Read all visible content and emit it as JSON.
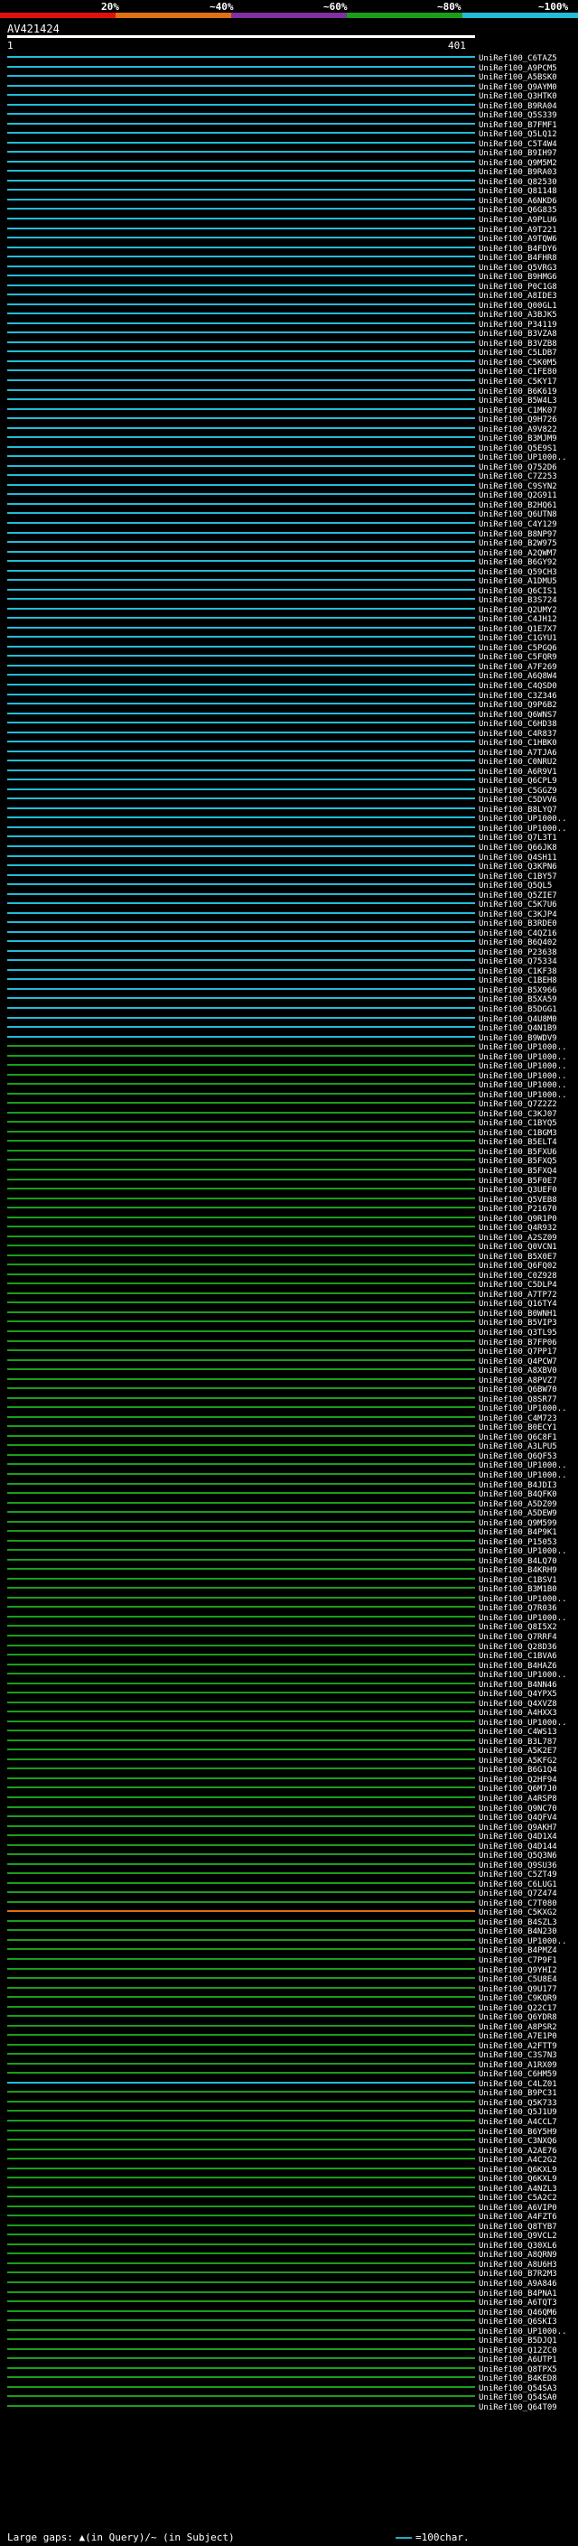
{
  "legend": {
    "labels": [
      "20%",
      "~40%",
      "~60%",
      "~80%",
      "~100%"
    ],
    "colors": [
      "#e01010",
      "#e07010",
      "#8030a0",
      "#1a9e1a",
      "#22bcd8"
    ]
  },
  "query": {
    "name": "AV421424",
    "start": "1",
    "end": "401"
  },
  "footer": {
    "text": "Large gaps: ▲(in Query)/~ (in Subject)",
    "scale_label": "=100char."
  },
  "hits": [
    {
      "id": "UniRef100_C6TAZ5",
      "identity": "100"
    },
    {
      "id": "UniRef100_A9PCM5",
      "identity": "100"
    },
    {
      "id": "UniRef100_A5BSK0",
      "identity": "100"
    },
    {
      "id": "UniRef100_Q9AYM0",
      "identity": "100"
    },
    {
      "id": "UniRef100_Q3HTK0",
      "identity": "100"
    },
    {
      "id": "UniRef100_B9RA04",
      "identity": "100"
    },
    {
      "id": "UniRef100_Q5S339",
      "identity": "100"
    },
    {
      "id": "UniRef100_B7FMF1",
      "identity": "100"
    },
    {
      "id": "UniRef100_Q5LQ12",
      "identity": "100"
    },
    {
      "id": "UniRef100_C5T4W4",
      "identity": "100"
    },
    {
      "id": "UniRef100_B9IH97",
      "identity": "100"
    },
    {
      "id": "UniRef100_Q9M5M2",
      "identity": "100"
    },
    {
      "id": "UniRef100_B9RA03",
      "identity": "100"
    },
    {
      "id": "UniRef100_Q82530",
      "identity": "100"
    },
    {
      "id": "UniRef100_Q81148",
      "identity": "100"
    },
    {
      "id": "UniRef100_A6NKD6",
      "identity": "100"
    },
    {
      "id": "UniRef100_Q6G835",
      "identity": "100"
    },
    {
      "id": "UniRef100_A9PLU6",
      "identity": "100"
    },
    {
      "id": "UniRef100_A9T221",
      "identity": "100"
    },
    {
      "id": "UniRef100_A9TQW6",
      "identity": "100"
    },
    {
      "id": "UniRef100_B4FDY6",
      "identity": "100"
    },
    {
      "id": "UniRef100_B4FHR8",
      "identity": "100"
    },
    {
      "id": "UniRef100_Q5VRG3",
      "identity": "100"
    },
    {
      "id": "UniRef100_B9HMG6",
      "identity": "100"
    },
    {
      "id": "UniRef100_P0C1G8",
      "identity": "100"
    },
    {
      "id": "UniRef100_A8IDE3",
      "identity": "100"
    },
    {
      "id": "UniRef100_Q00GL1",
      "identity": "100"
    },
    {
      "id": "UniRef100_A3BJK5",
      "identity": "100"
    },
    {
      "id": "UniRef100_P34119",
      "identity": "100"
    },
    {
      "id": "UniRef100_B3VZA8",
      "identity": "100"
    },
    {
      "id": "UniRef100_B3VZB8",
      "identity": "100"
    },
    {
      "id": "UniRef100_C5LDB7",
      "identity": "100"
    },
    {
      "id": "UniRef100_C5K0M5",
      "identity": "100"
    },
    {
      "id": "UniRef100_C1FE80",
      "identity": "100"
    },
    {
      "id": "UniRef100_C5KY17",
      "identity": "100"
    },
    {
      "id": "UniRef100_B6K619",
      "identity": "100"
    },
    {
      "id": "UniRef100_B5W4L3",
      "identity": "100"
    },
    {
      "id": "UniRef100_C1MK07",
      "identity": "100"
    },
    {
      "id": "UniRef100_Q9H726",
      "identity": "100"
    },
    {
      "id": "UniRef100_A9V822",
      "identity": "100"
    },
    {
      "id": "UniRef100_B3MJM9",
      "identity": "100"
    },
    {
      "id": "UniRef100_Q5E9S1",
      "identity": "100"
    },
    {
      "id": "UniRef100_UP1000..",
      "identity": "100"
    },
    {
      "id": "UniRef100_Q752D6",
      "identity": "100"
    },
    {
      "id": "UniRef100_C7Z253",
      "identity": "100"
    },
    {
      "id": "UniRef100_C9SYN2",
      "identity": "100"
    },
    {
      "id": "UniRef100_Q2G911",
      "identity": "100"
    },
    {
      "id": "UniRef100_B2HQ61",
      "identity": "100"
    },
    {
      "id": "UniRef100_Q6UTN8",
      "identity": "100"
    },
    {
      "id": "UniRef100_C4Y129",
      "identity": "100"
    },
    {
      "id": "UniRef100_B8NP97",
      "identity": "100"
    },
    {
      "id": "UniRef100_B2W975",
      "identity": "100"
    },
    {
      "id": "UniRef100_A2QWM7",
      "identity": "100"
    },
    {
      "id": "UniRef100_B6GY92",
      "identity": "100"
    },
    {
      "id": "UniRef100_Q59CH3",
      "identity": "100"
    },
    {
      "id": "UniRef100_A1DMU5",
      "identity": "100"
    },
    {
      "id": "UniRef100_Q6CIS1",
      "identity": "100"
    },
    {
      "id": "UniRef100_B3S724",
      "identity": "100"
    },
    {
      "id": "UniRef100_Q2UMY2",
      "identity": "100"
    },
    {
      "id": "UniRef100_C4JH12",
      "identity": "100"
    },
    {
      "id": "UniRef100_Q1E7X7",
      "identity": "100"
    },
    {
      "id": "UniRef100_C1GYU1",
      "identity": "100"
    },
    {
      "id": "UniRef100_C5PGQ6",
      "identity": "100"
    },
    {
      "id": "UniRef100_C5FQR9",
      "identity": "100"
    },
    {
      "id": "UniRef100_A7F269",
      "identity": "100"
    },
    {
      "id": "UniRef100_A6Q8W4",
      "identity": "100"
    },
    {
      "id": "UniRef100_C4QSD0",
      "identity": "100"
    },
    {
      "id": "UniRef100_C3Z346",
      "identity": "100"
    },
    {
      "id": "UniRef100_Q9P6B2",
      "identity": "100"
    },
    {
      "id": "UniRef100_Q6WNS7",
      "identity": "100"
    },
    {
      "id": "UniRef100_C6HD38",
      "identity": "100"
    },
    {
      "id": "UniRef100_C4R837",
      "identity": "100"
    },
    {
      "id": "UniRef100_C1HBK0",
      "identity": "100"
    },
    {
      "id": "UniRef100_A7TJA6",
      "identity": "100"
    },
    {
      "id": "UniRef100_C0NRU2",
      "identity": "100"
    },
    {
      "id": "UniRef100_A6R9V1",
      "identity": "100"
    },
    {
      "id": "UniRef100_Q6CPL9",
      "identity": "100"
    },
    {
      "id": "UniRef100_C5GGZ9",
      "identity": "100"
    },
    {
      "id": "UniRef100_C5DVV6",
      "identity": "100"
    },
    {
      "id": "UniRef100_B8LYQ7",
      "identity": "100"
    },
    {
      "id": "UniRef100_UP1000..",
      "identity": "100"
    },
    {
      "id": "UniRef100_UP1000..",
      "identity": "100"
    },
    {
      "id": "UniRef100_Q7L3T1",
      "identity": "100"
    },
    {
      "id": "UniRef100_Q66JK8",
      "identity": "100"
    },
    {
      "id": "UniRef100_Q4SH11",
      "identity": "100"
    },
    {
      "id": "UniRef100_Q3KPN6",
      "identity": "100"
    },
    {
      "id": "UniRef100_C1BY57",
      "identity": "100"
    },
    {
      "id": "UniRef100_Q5QL5",
      "identity": "100"
    },
    {
      "id": "UniRef100_Q5ZIE7",
      "identity": "100"
    },
    {
      "id": "UniRef100_C5K7U6",
      "identity": "100"
    },
    {
      "id": "UniRef100_C3KJP4",
      "identity": "100"
    },
    {
      "id": "UniRef100_B3RDE0",
      "identity": "100"
    },
    {
      "id": "UniRef100_C4QZ16",
      "identity": "100"
    },
    {
      "id": "UniRef100_B6Q402",
      "identity": "100"
    },
    {
      "id": "UniRef100_P23638",
      "identity": "100"
    },
    {
      "id": "UniRef100_Q75334",
      "identity": "100"
    },
    {
      "id": "UniRef100_C1KF38",
      "identity": "100"
    },
    {
      "id": "UniRef100_C1BEH8",
      "identity": "100"
    },
    {
      "id": "UniRef100_B5X966",
      "identity": "100"
    },
    {
      "id": "UniRef100_B5XA59",
      "identity": "100"
    },
    {
      "id": "UniRef100_B5DGG1",
      "identity": "100"
    },
    {
      "id": "UniRef100_Q4U8M0",
      "identity": "100"
    },
    {
      "id": "UniRef100_Q4N1B9",
      "identity": "100"
    },
    {
      "id": "UniRef100_B9WDV9",
      "identity": "100"
    },
    {
      "id": "UniRef100_UP1000..",
      "identity": "80"
    },
    {
      "id": "UniRef100_UP1000..",
      "identity": "80"
    },
    {
      "id": "UniRef100_UP1000..",
      "identity": "80"
    },
    {
      "id": "UniRef100_UP1000..",
      "identity": "80"
    },
    {
      "id": "UniRef100_UP1000..",
      "identity": "80"
    },
    {
      "id": "UniRef100_UP1000..",
      "identity": "80"
    },
    {
      "id": "UniRef100_Q7Z2Z2",
      "identity": "80"
    },
    {
      "id": "UniRef100_C3KJ07",
      "identity": "80"
    },
    {
      "id": "UniRef100_C1BYQ5",
      "identity": "80"
    },
    {
      "id": "UniRef100_C1BGM3",
      "identity": "80"
    },
    {
      "id": "UniRef100_B5ELT4",
      "identity": "80"
    },
    {
      "id": "UniRef100_B5FXU6",
      "identity": "80"
    },
    {
      "id": "UniRef100_B5FXQ5",
      "identity": "80"
    },
    {
      "id": "UniRef100_B5FXQ4",
      "identity": "80"
    },
    {
      "id": "UniRef100_B5F0E7",
      "identity": "80"
    },
    {
      "id": "UniRef100_Q3UEF0",
      "identity": "80"
    },
    {
      "id": "UniRef100_Q5VEB8",
      "identity": "80"
    },
    {
      "id": "UniRef100_P21670",
      "identity": "80"
    },
    {
      "id": "UniRef100_Q9R1P0",
      "identity": "80"
    },
    {
      "id": "UniRef100_Q4R932",
      "identity": "80"
    },
    {
      "id": "UniRef100_A2SZ09",
      "identity": "80"
    },
    {
      "id": "UniRef100_Q0VCN1",
      "identity": "80"
    },
    {
      "id": "UniRef100_B5X0E7",
      "identity": "80"
    },
    {
      "id": "UniRef100_Q6FQ02",
      "identity": "80"
    },
    {
      "id": "UniRef100_C0Z928",
      "identity": "80"
    },
    {
      "id": "UniRef100_C5DLP4",
      "identity": "80"
    },
    {
      "id": "UniRef100_A7TP72",
      "identity": "80"
    },
    {
      "id": "UniRef100_Q16TY4",
      "identity": "80"
    },
    {
      "id": "UniRef100_B0WNH1",
      "identity": "80"
    },
    {
      "id": "UniRef100_B5VIP3",
      "identity": "80"
    },
    {
      "id": "UniRef100_Q3TL95",
      "identity": "80"
    },
    {
      "id": "UniRef100_B7FP06",
      "identity": "80"
    },
    {
      "id": "UniRef100_Q7PP17",
      "identity": "80"
    },
    {
      "id": "UniRef100_Q4PCW7",
      "identity": "80"
    },
    {
      "id": "UniRef100_A8XBV0",
      "identity": "80"
    },
    {
      "id": "UniRef100_A8PVZ7",
      "identity": "80"
    },
    {
      "id": "UniRef100_Q6BW70",
      "identity": "80"
    },
    {
      "id": "UniRef100_Q8SR77",
      "identity": "80"
    },
    {
      "id": "UniRef100_UP1000..",
      "identity": "80"
    },
    {
      "id": "UniRef100_C4M723",
      "identity": "80"
    },
    {
      "id": "UniRef100_B0ECY1",
      "identity": "80"
    },
    {
      "id": "UniRef100_Q6C8F1",
      "identity": "80"
    },
    {
      "id": "UniRef100_A3LPU5",
      "identity": "80"
    },
    {
      "id": "UniRef100_Q6QF53",
      "identity": "80"
    },
    {
      "id": "UniRef100_UP1000..",
      "identity": "80"
    },
    {
      "id": "UniRef100_UP1000..",
      "identity": "80"
    },
    {
      "id": "UniRef100_B4JDI3",
      "identity": "80"
    },
    {
      "id": "UniRef100_B4QFK0",
      "identity": "80"
    },
    {
      "id": "UniRef100_A5DZ09",
      "identity": "80"
    },
    {
      "id": "UniRef100_A5DEW9",
      "identity": "80"
    },
    {
      "id": "UniRef100_Q9M599",
      "identity": "80"
    },
    {
      "id": "UniRef100_B4P9K1",
      "identity": "80"
    },
    {
      "id": "UniRef100_P15053",
      "identity": "80"
    },
    {
      "id": "UniRef100_UP1000..",
      "identity": "80"
    },
    {
      "id": "UniRef100_B4LQ70",
      "identity": "80"
    },
    {
      "id": "UniRef100_B4KRH9",
      "identity": "80"
    },
    {
      "id": "UniRef100_C1BSV1",
      "identity": "80"
    },
    {
      "id": "UniRef100_B3M1B0",
      "identity": "80"
    },
    {
      "id": "UniRef100_UP1000..",
      "identity": "80"
    },
    {
      "id": "UniRef100_Q7R036",
      "identity": "80"
    },
    {
      "id": "UniRef100_UP1000..",
      "identity": "80"
    },
    {
      "id": "UniRef100_Q8I5X2",
      "identity": "80"
    },
    {
      "id": "UniRef100_Q7RRF4",
      "identity": "80"
    },
    {
      "id": "UniRef100_Q28D36",
      "identity": "80"
    },
    {
      "id": "UniRef100_C1BVA6",
      "identity": "80"
    },
    {
      "id": "UniRef100_B4HAZ6",
      "identity": "80"
    },
    {
      "id": "UniRef100_UP1000..",
      "identity": "80"
    },
    {
      "id": "UniRef100_B4NN46",
      "identity": "80"
    },
    {
      "id": "UniRef100_Q4YPX5",
      "identity": "80"
    },
    {
      "id": "UniRef100_Q4XVZ8",
      "identity": "80"
    },
    {
      "id": "UniRef100_A4HXX3",
      "identity": "80"
    },
    {
      "id": "UniRef100_UP1000..",
      "identity": "80"
    },
    {
      "id": "UniRef100_C4WS13",
      "identity": "80"
    },
    {
      "id": "UniRef100_B3L787",
      "identity": "80"
    },
    {
      "id": "UniRef100_A5K2E7",
      "identity": "80"
    },
    {
      "id": "UniRef100_A5KFG2",
      "identity": "80"
    },
    {
      "id": "UniRef100_B6G1Q4",
      "identity": "80"
    },
    {
      "id": "UniRef100_Q2HF94",
      "identity": "80"
    },
    {
      "id": "UniRef100_Q6M7J0",
      "identity": "80"
    },
    {
      "id": "UniRef100_A4RSP8",
      "identity": "80"
    },
    {
      "id": "UniRef100_Q9NC70",
      "identity": "80"
    },
    {
      "id": "UniRef100_Q4QFV4",
      "identity": "80"
    },
    {
      "id": "UniRef100_Q9AKH7",
      "identity": "80"
    },
    {
      "id": "UniRef100_Q4D1X4",
      "identity": "80"
    },
    {
      "id": "UniRef100_Q4D144",
      "identity": "80"
    },
    {
      "id": "UniRef100_Q5Q3N6",
      "identity": "80"
    },
    {
      "id": "UniRef100_Q9SU36",
      "identity": "80"
    },
    {
      "id": "UniRef100_C5ZT49",
      "identity": "80"
    },
    {
      "id": "UniRef100_C6LUG1",
      "identity": "80"
    },
    {
      "id": "UniRef100_Q7Z474",
      "identity": "80"
    },
    {
      "id": "UniRef100_C7T080",
      "identity": "80"
    },
    {
      "id": "UniRef100_C5KXG2",
      "identity": "40"
    },
    {
      "id": "UniRef100_B4SZL3",
      "identity": "80"
    },
    {
      "id": "UniRef100_B4N230",
      "identity": "80"
    },
    {
      "id": "UniRef100_UP1000..",
      "identity": "80"
    },
    {
      "id": "UniRef100_B4PMZ4",
      "identity": "80"
    },
    {
      "id": "UniRef100_C7P9F1",
      "identity": "80"
    },
    {
      "id": "UniRef100_Q9YHI2",
      "identity": "80"
    },
    {
      "id": "UniRef100_C5U8E4",
      "identity": "80"
    },
    {
      "id": "UniRef100_Q9U177",
      "identity": "80"
    },
    {
      "id": "UniRef100_C9KQR9",
      "identity": "80"
    },
    {
      "id": "UniRef100_Q22C17",
      "identity": "80"
    },
    {
      "id": "UniRef100_Q6YDR8",
      "identity": "80"
    },
    {
      "id": "UniRef100_A8PSR2",
      "identity": "80"
    },
    {
      "id": "UniRef100_A7E1P0",
      "identity": "80"
    },
    {
      "id": "UniRef100_A2FTT9",
      "identity": "80"
    },
    {
      "id": "UniRef100_C3S7N3",
      "identity": "80"
    },
    {
      "id": "UniRef100_A1RX09",
      "identity": "80"
    },
    {
      "id": "UniRef100_C6HM59",
      "identity": "80"
    },
    {
      "id": "UniRef100_C4LZ01",
      "identity": "100"
    },
    {
      "id": "UniRef100_B9PC31",
      "identity": "80"
    },
    {
      "id": "UniRef100_Q5K733",
      "identity": "80"
    },
    {
      "id": "UniRef100_Q5J1U9",
      "identity": "80"
    },
    {
      "id": "UniRef100_A4CCL7",
      "identity": "80"
    },
    {
      "id": "UniRef100_B6Y5H9",
      "identity": "80"
    },
    {
      "id": "UniRef100_C3NXQ6",
      "identity": "80"
    },
    {
      "id": "UniRef100_A2AE76",
      "identity": "80"
    },
    {
      "id": "UniRef100_A4C2G2",
      "identity": "80"
    },
    {
      "id": "UniRef100_Q6KXL9",
      "identity": "80"
    },
    {
      "id": "UniRef100_Q6KXL9",
      "identity": "80"
    },
    {
      "id": "UniRef100_A4NZL3",
      "identity": "80"
    },
    {
      "id": "UniRef100_C5A2C2",
      "identity": "80"
    },
    {
      "id": "UniRef100_A6VIP0",
      "identity": "80"
    },
    {
      "id": "UniRef100_A4FZT6",
      "identity": "80"
    },
    {
      "id": "UniRef100_Q8TYB7",
      "identity": "80"
    },
    {
      "id": "UniRef100_Q9VCL2",
      "identity": "80"
    },
    {
      "id": "UniRef100_Q30XL6",
      "identity": "80"
    },
    {
      "id": "UniRef100_A8QRN9",
      "identity": "80"
    },
    {
      "id": "UniRef100_A8U6H3",
      "identity": "80"
    },
    {
      "id": "UniRef100_B7R2M3",
      "identity": "80"
    },
    {
      "id": "UniRef100_A9A846",
      "identity": "80"
    },
    {
      "id": "UniRef100_B4PNA1",
      "identity": "80"
    },
    {
      "id": "UniRef100_A6TQT3",
      "identity": "80"
    },
    {
      "id": "UniRef100_Q46QM6",
      "identity": "80"
    },
    {
      "id": "UniRef100_Q6SKI3",
      "identity": "80"
    },
    {
      "id": "UniRef100_UP1000..",
      "identity": "80"
    },
    {
      "id": "UniRef100_B5DJQ1",
      "identity": "80"
    },
    {
      "id": "UniRef100_Q12ZC0",
      "identity": "80"
    },
    {
      "id": "UniRef100_A6UTP1",
      "identity": "80"
    },
    {
      "id": "UniRef100_Q8TPX5",
      "identity": "80"
    },
    {
      "id": "UniRef100_B4KED8",
      "identity": "80"
    },
    {
      "id": "UniRef100_Q54SA3",
      "identity": "80"
    },
    {
      "id": "UniRef100_Q54SA0",
      "identity": "80"
    },
    {
      "id": "UniRef100_Q64T09",
      "identity": "80"
    }
  ]
}
